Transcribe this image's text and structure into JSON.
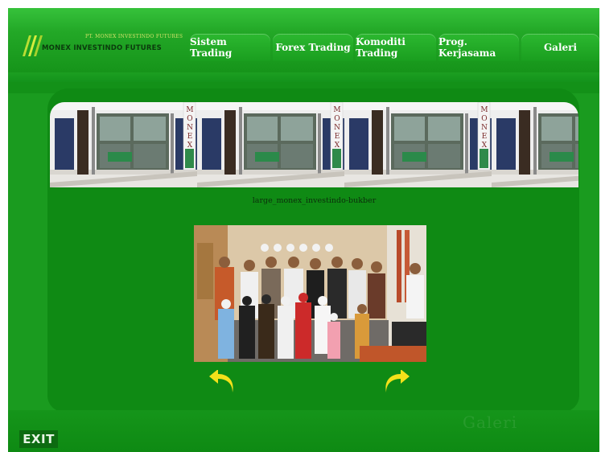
{
  "brand": {
    "tagline": "PT. MONEX INVESTINDO FUTURES",
    "name": "MONEX INVESTINDO FUTURES"
  },
  "nav": [
    {
      "label": "Sistem Trading"
    },
    {
      "label": "Forex Trading"
    },
    {
      "label": "Komoditi Trading"
    },
    {
      "label": "Prog. Kerjasama"
    },
    {
      "label": "Galeri"
    }
  ],
  "banner": {
    "sign_text": "MONEX"
  },
  "gallery": {
    "caption": "large_monex_investindo-bukber"
  },
  "controls": {
    "exit_label": "EXIT",
    "prev_arrow": "arrow-left-icon",
    "next_arrow": "arrow-right-icon"
  },
  "watermark": "Galeri",
  "colors": {
    "background": "#1a9b1f",
    "panel": "#0f8a14",
    "arrow": "#f3e11a",
    "exit": "#0d6b11"
  }
}
